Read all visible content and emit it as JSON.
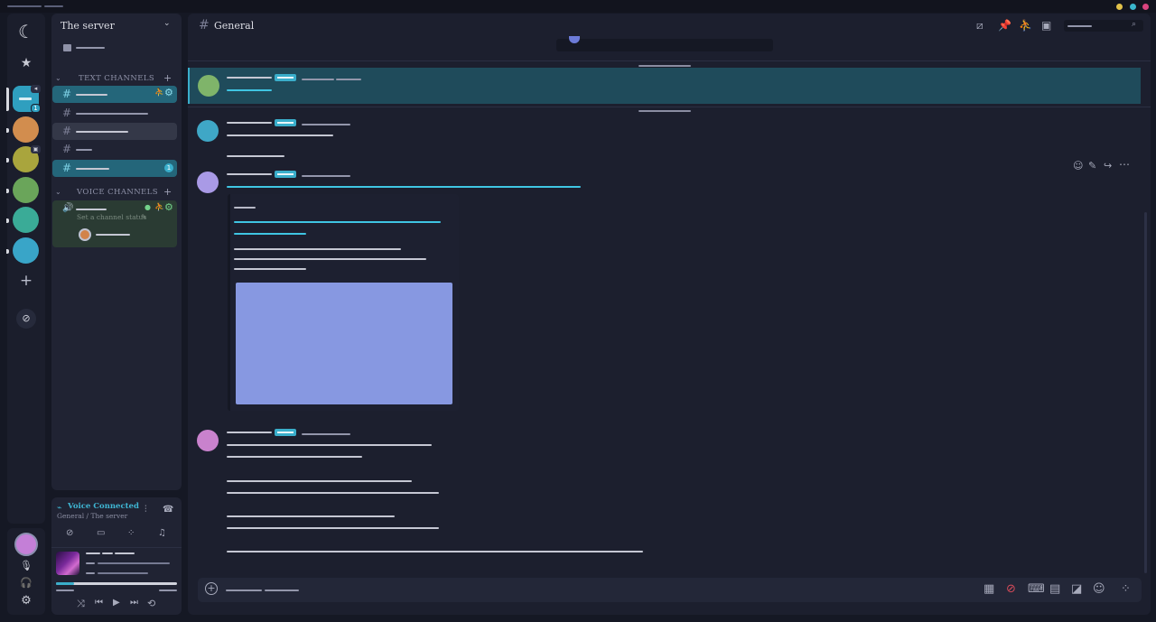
{
  "window": {
    "controls": [
      {
        "name": "minimize",
        "color": "#e2c24a"
      },
      {
        "name": "maximize",
        "color": "#3ab6cc"
      },
      {
        "name": "close",
        "color": "#d9447e"
      }
    ]
  },
  "rail": {
    "servers": [
      {
        "color": "#2f9fbf",
        "badge": "1"
      },
      {
        "color": "#d28d4e"
      },
      {
        "color": "#a9a53d"
      },
      {
        "color": "#6aa55a"
      },
      {
        "color": "#3aab97"
      },
      {
        "color": "#39a5c8"
      }
    ],
    "user_color": "#c47fd7"
  },
  "server": {
    "name": "The server",
    "text_category": "TEXT CHANNELS",
    "voice_category": "VOICE CHANNELS",
    "channel_badge": "1",
    "voice_status_placeholder": "Set a channel status"
  },
  "channel": {
    "name": "General"
  },
  "messages": [
    {
      "avatar": "#7fb46a"
    },
    {
      "avatar": "#3fa7c6"
    },
    {
      "avatar": "#a99ae6"
    },
    {
      "avatar": "#c982cd"
    }
  ],
  "embed": {
    "image_color": "#8798e1"
  },
  "voice_panel": {
    "status": "Voice Connected",
    "location": "General / The server",
    "progress": 0.15
  }
}
